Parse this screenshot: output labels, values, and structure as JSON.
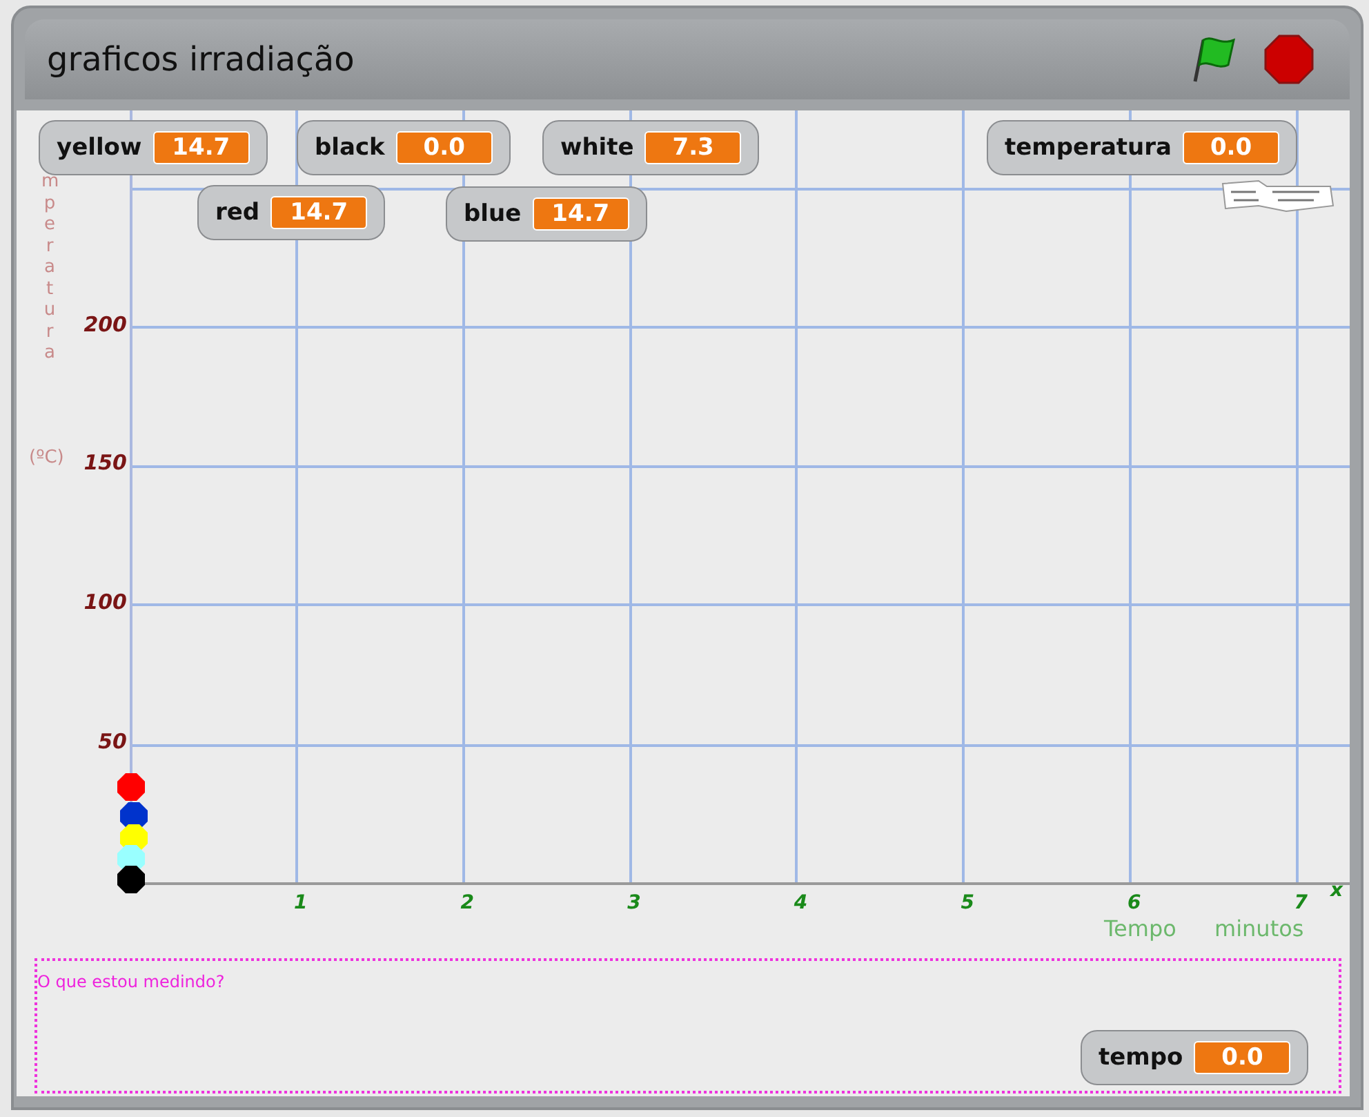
{
  "window": {
    "title": "graficos irradiação"
  },
  "controls": [
    {
      "kind": "flag"
    },
    {
      "kind": "stop"
    }
  ],
  "monitors": [
    {
      "label": "yellow",
      "value": "14.7"
    },
    {
      "label": "black",
      "value": "0.0"
    },
    {
      "label": "white",
      "value": "7.3"
    },
    {
      "label": "temperatura",
      "value": "0.0"
    },
    {
      "label": "red",
      "value": "14.7"
    },
    {
      "label": "blue",
      "value": "14.7"
    },
    {
      "label": "tempo",
      "value": "0.0"
    }
  ],
  "y_axis": {
    "title": "mperatura",
    "unit": "(ºC)",
    "ticks": [
      "200",
      "150",
      "100",
      "50"
    ]
  },
  "x_axis": {
    "end_label": "x",
    "ticks": [
      "1",
      "2",
      "3",
      "4",
      "5",
      "6",
      "7"
    ],
    "title_parts": [
      "Tempo",
      "minutos"
    ]
  },
  "markers": [
    {
      "color": "#ff0000"
    },
    {
      "color": "#0033cc"
    },
    {
      "color": "#ffff00"
    },
    {
      "color": "#99ffff"
    },
    {
      "color": "#000000"
    }
  ],
  "note": {
    "text": "O que estou medindo?"
  }
}
